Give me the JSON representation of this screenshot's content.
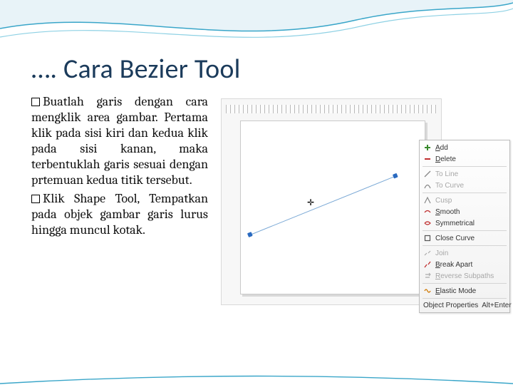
{
  "title": "…. Cara Bezier Tool",
  "paragraphs": {
    "p1": "Buatlah garis dengan cara mengklik area gambar. Pertama klik pada sisi kiri dan kedua klik pada sisi kanan, maka terbentuklah garis sesuai dengan prtemuan kedua titik tersebut.",
    "p2": "Klik Shape Tool, Tempatkan pada objek gambar garis lurus hingga muncul kotak."
  },
  "context_menu": {
    "items": [
      {
        "label": "Add",
        "enabled": true,
        "icon": "plus-icon",
        "accel": "A"
      },
      {
        "label": "Delete",
        "enabled": true,
        "icon": "minus-icon",
        "accel": "D"
      },
      {
        "sep": true
      },
      {
        "label": "To Line",
        "enabled": false,
        "icon": "toline-icon"
      },
      {
        "label": "To Curve",
        "enabled": false,
        "icon": "tocurve-icon"
      },
      {
        "sep": true
      },
      {
        "label": "Cusp",
        "enabled": false,
        "icon": "cusp-icon"
      },
      {
        "label": "Smooth",
        "enabled": true,
        "icon": "smooth-icon",
        "accel": "S"
      },
      {
        "label": "Symmetrical",
        "enabled": true,
        "icon": "symmetrical-icon"
      },
      {
        "sep": true
      },
      {
        "label": "Close Curve",
        "enabled": true,
        "icon": "close-icon"
      },
      {
        "sep": true
      },
      {
        "label": "Join",
        "enabled": false,
        "icon": "join-icon"
      },
      {
        "label": "Break Apart",
        "enabled": true,
        "icon": "break-icon",
        "accel": "B"
      },
      {
        "label": "Reverse Subpaths",
        "enabled": false,
        "icon": "reverse-icon",
        "accel": "R"
      },
      {
        "sep": true
      },
      {
        "label": "Elastic Mode",
        "enabled": true,
        "icon": "elastic-icon",
        "accel": "E"
      },
      {
        "sep": true
      },
      {
        "label_left": "Object Properties",
        "label_right": "Alt+Enter",
        "shortcut": true
      }
    ]
  },
  "iconset": {
    "plus": "＋",
    "minus": "−",
    "diag": "↘",
    "curve": "◠"
  }
}
